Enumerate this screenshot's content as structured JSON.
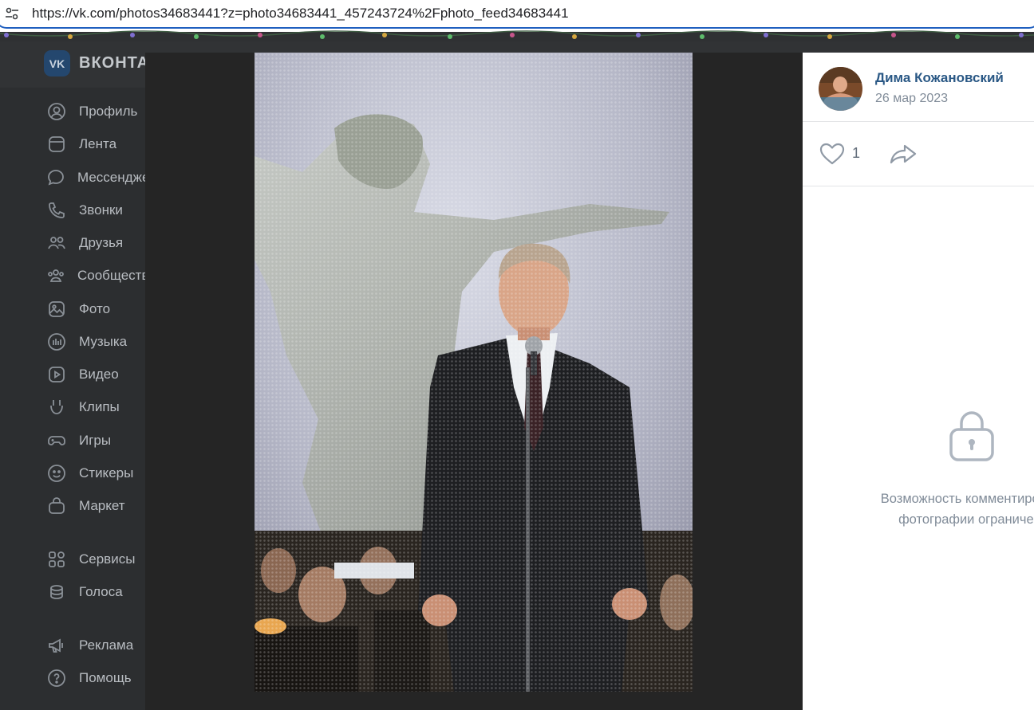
{
  "browser": {
    "url": "https://vk.com/photos34683441?z=photo34683441_457243724%2Fphoto_feed34683441"
  },
  "site": {
    "logo_text": "VK",
    "brand": "ВКОНТАКТЕ"
  },
  "nav": {
    "items": [
      {
        "label": "Профиль",
        "icon": "user-circle-icon"
      },
      {
        "label": "Лента",
        "icon": "feed-icon"
      },
      {
        "label": "Мессенджер",
        "icon": "message-icon"
      },
      {
        "label": "Звонки",
        "icon": "phone-icon"
      },
      {
        "label": "Друзья",
        "icon": "friends-icon"
      },
      {
        "label": "Сообщества",
        "icon": "communities-icon"
      },
      {
        "label": "Фото",
        "icon": "photo-icon"
      },
      {
        "label": "Музыка",
        "icon": "music-icon"
      },
      {
        "label": "Видео",
        "icon": "video-icon"
      },
      {
        "label": "Клипы",
        "icon": "clips-icon"
      },
      {
        "label": "Игры",
        "icon": "gamepad-icon"
      },
      {
        "label": "Стикеры",
        "icon": "sticker-icon"
      },
      {
        "label": "Маркет",
        "icon": "bag-icon"
      },
      {
        "label": "Сервисы",
        "icon": "services-icon"
      },
      {
        "label": "Голоса",
        "icon": "coins-icon"
      },
      {
        "label": "Реклама",
        "icon": "megaphone-icon"
      },
      {
        "label": "Помощь",
        "icon": "help-icon"
      }
    ]
  },
  "post": {
    "author": "Дима Кожановский",
    "date": "26 мар 2023",
    "likes": "1",
    "comments_locked_line1": "Возможность комментировать",
    "comments_locked_line2": "фотографии ограничена"
  },
  "colors": {
    "accent": "#2a5885",
    "muted": "#818c99",
    "overlay": "#2c2e30",
    "viewer_bg": "#252525"
  }
}
